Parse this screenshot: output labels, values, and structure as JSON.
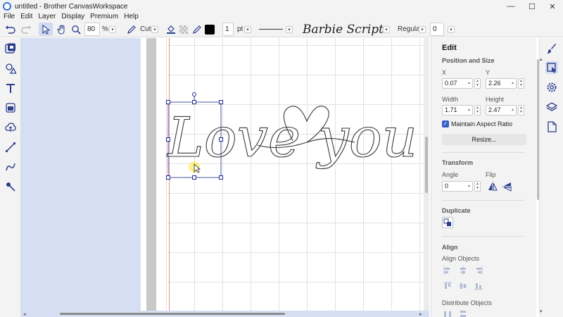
{
  "window": {
    "title": "untitled - Brother CanvasWorkspace",
    "controls": {
      "minimize": "—",
      "maximize": "☐",
      "close": "✕"
    }
  },
  "menu": [
    "File",
    "Edit",
    "Layer",
    "Display",
    "Premium",
    "Help"
  ],
  "toolbar": {
    "zoom_value": "80",
    "zoom_unit": "%",
    "cut_label": "Cut",
    "fill_color": "#000000",
    "line_width": "1",
    "line_unit": "pt",
    "font_name": "Barbie Script",
    "font_style": "Regular",
    "font_spacing": "0"
  },
  "canvas": {
    "artwork_text": "Love you",
    "accent_color": "#1a2a8c"
  },
  "panel": {
    "title": "Edit",
    "position_size": "Position and Size",
    "x_label": "X",
    "x_value": "0.07",
    "y_label": "Y",
    "y_value": "2.26",
    "width_label": "Width",
    "width_value": "1.71",
    "height_label": "Height",
    "height_value": "2.47",
    "maintain_aspect": "Maintain Aspect Ratio",
    "resize_button": "Resize...",
    "transform": "Transform",
    "angle_label": "Angle",
    "angle_value": "0",
    "flip_label": "Flip",
    "duplicate": "Duplicate",
    "align": "Align",
    "align_objects": "Align Objects",
    "distribute_objects": "Distribute Objects"
  },
  "icons": {
    "left_tools": [
      "select-icon",
      "shapes-icon",
      "text-icon",
      "import-icon",
      "cloud-icon",
      "line-icon",
      "freehand-icon",
      "node-edit-icon"
    ],
    "right_tabs": [
      "brush-icon",
      "edit-object-icon",
      "gear-icon",
      "layers-icon",
      "page-icon"
    ]
  }
}
